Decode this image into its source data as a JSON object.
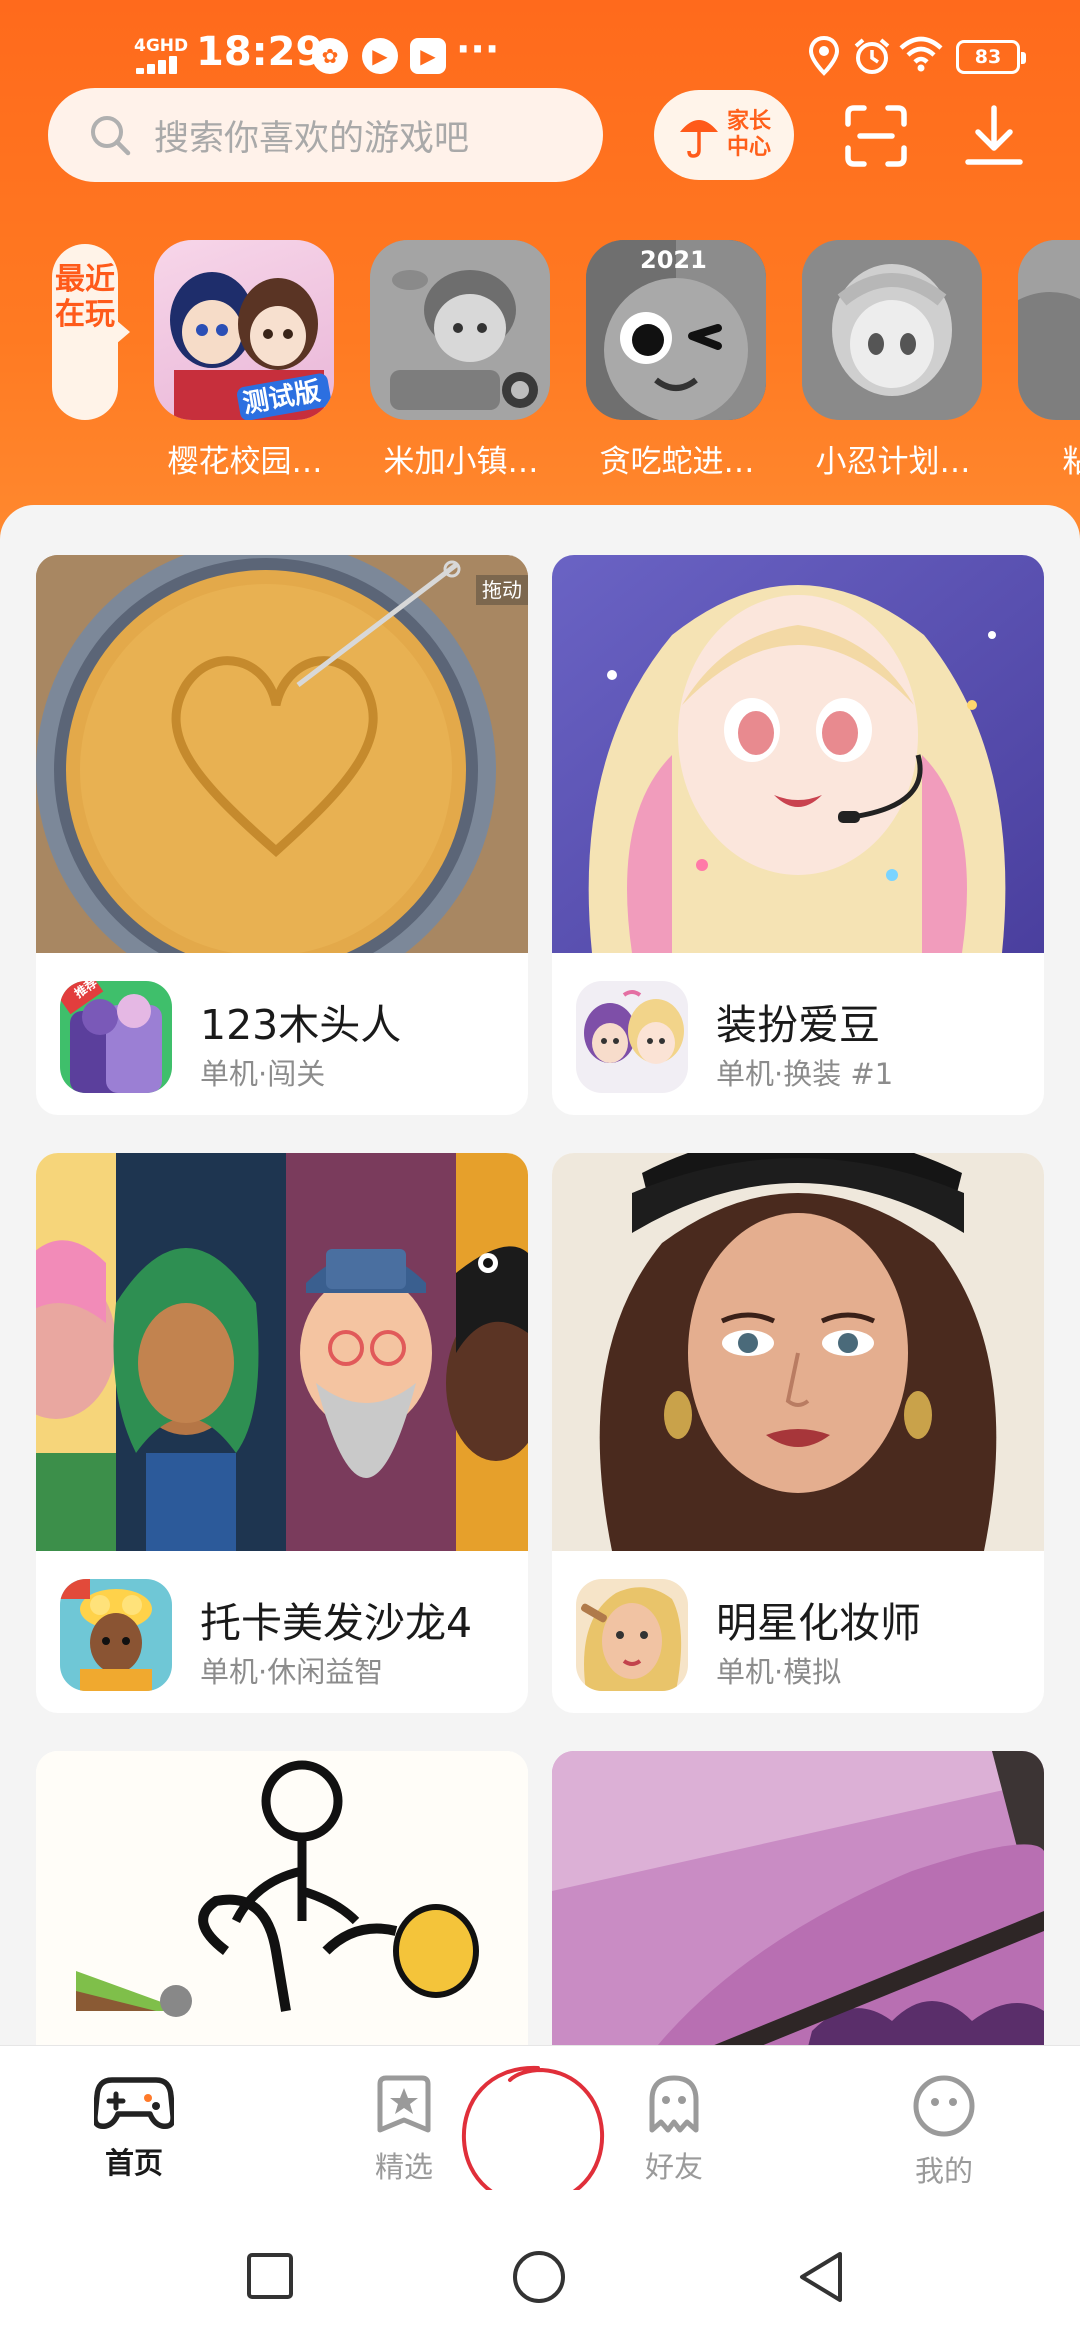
{
  "status_bar": {
    "network": "4GHD",
    "time": "18:29",
    "more": "···",
    "battery": "83"
  },
  "search": {
    "placeholder": "搜索你喜欢的游戏吧"
  },
  "header": {
    "parent_center_label": "家长\n中心"
  },
  "recent": {
    "label": "最近在玩",
    "games": [
      {
        "name": "樱花校园…",
        "badge": "测试版"
      },
      {
        "name": "米加小镇…"
      },
      {
        "name": "贪吃蛇进…",
        "badge": "2021"
      },
      {
        "name": "小忍计划…"
      },
      {
        "name": "粘土…"
      }
    ]
  },
  "cards": [
    {
      "title": "123木头人",
      "subtitle": "单机·闯关",
      "cover_caption": "拖动",
      "icon_badge": "推荐"
    },
    {
      "title": "装扮爱豆",
      "subtitle": "单机·换装  #1"
    },
    {
      "title": "托卡美发沙龙4",
      "subtitle": "单机·休闲益智"
    },
    {
      "title": "明星化妆师",
      "subtitle": "单机·模拟"
    },
    {
      "title": "",
      "subtitle": ""
    },
    {
      "title": "",
      "subtitle": ""
    }
  ],
  "bottom_nav": {
    "items": [
      {
        "label": "首页",
        "active": true
      },
      {
        "label": "精选"
      },
      {
        "label": "好友"
      },
      {
        "label": "我的"
      }
    ]
  },
  "colors": {
    "brand": "#ff6a1c",
    "annotation": "#e02f3a"
  }
}
